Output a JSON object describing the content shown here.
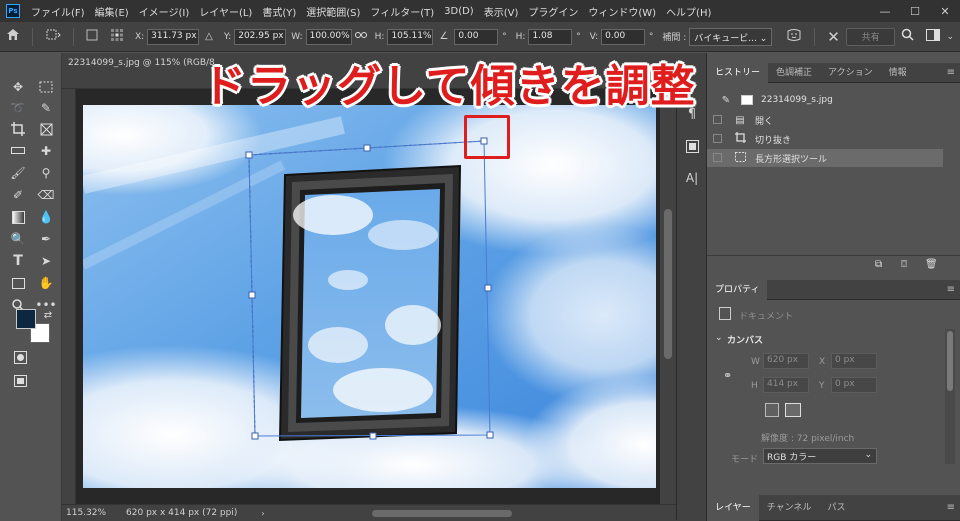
{
  "app": {
    "logo": "Ps"
  },
  "menu": [
    "ファイル(F)",
    "編集(E)",
    "イメージ(I)",
    "レイヤー(L)",
    "書式(Y)",
    "選択範囲(S)",
    "フィルター(T)",
    "3D(D)",
    "表示(V)",
    "プラグイン",
    "ウィンドウ(W)",
    "ヘルプ(H)"
  ],
  "window_controls": {
    "minimize": "—",
    "maximize": "☐",
    "close": "✕"
  },
  "options": {
    "x_label": "X:",
    "x_value": "311.73 px",
    "y_label": "Y:",
    "y_value": "202.95 px",
    "w_label": "W:",
    "w_value": "100.00%",
    "h_label": "H:",
    "h_value": "105.11%",
    "angle_value": "0.00",
    "angle_unit": "°",
    "hskew_label": "H:",
    "hskew_value": "1.08",
    "hskew_unit": "°",
    "vskew_label": "V:",
    "vskew_value": "0.00",
    "vskew_unit": "°",
    "interp_label": "補間 :",
    "interp_value": "バイキュービ...",
    "share": "共有"
  },
  "document": {
    "tab_title": "22314099_s.jpg @ 115% (RGB/8",
    "zoom": "115.32%",
    "size_info": "620 px x 414 px (72 ppi)"
  },
  "annotation": {
    "text": "ドラッグして傾きを調整"
  },
  "history_panel": {
    "tabs": [
      "ヒストリー",
      "色調補正",
      "アクション",
      "情報"
    ],
    "snapshot": "22314099_s.jpg",
    "items": [
      {
        "label": "開く",
        "icon": "document-icon"
      },
      {
        "label": "切り抜き",
        "icon": "crop-icon"
      },
      {
        "label": "長方形選択ツール",
        "icon": "marquee-icon"
      }
    ]
  },
  "properties_panel": {
    "tab": "プロパティ",
    "doc_label": "ドキュメント",
    "section": "カンバス",
    "w_label": "W",
    "w_value": "620 px",
    "x_label": "X",
    "x_value": "0 px",
    "h_label": "H",
    "h_value": "414 px",
    "y_label": "Y",
    "y_value": "0 px",
    "resolution": "解像度 : 72 pixel/inch",
    "mode_label": "モード",
    "mode_value": "RGB カラー"
  },
  "layers_panel": {
    "tabs": [
      "レイヤー",
      "チャンネル",
      "パス"
    ]
  },
  "colors": {
    "accent": "#31a8ff",
    "annotation": "#e01d1d",
    "foreground": "#0d2740",
    "background": "#ffffff"
  }
}
